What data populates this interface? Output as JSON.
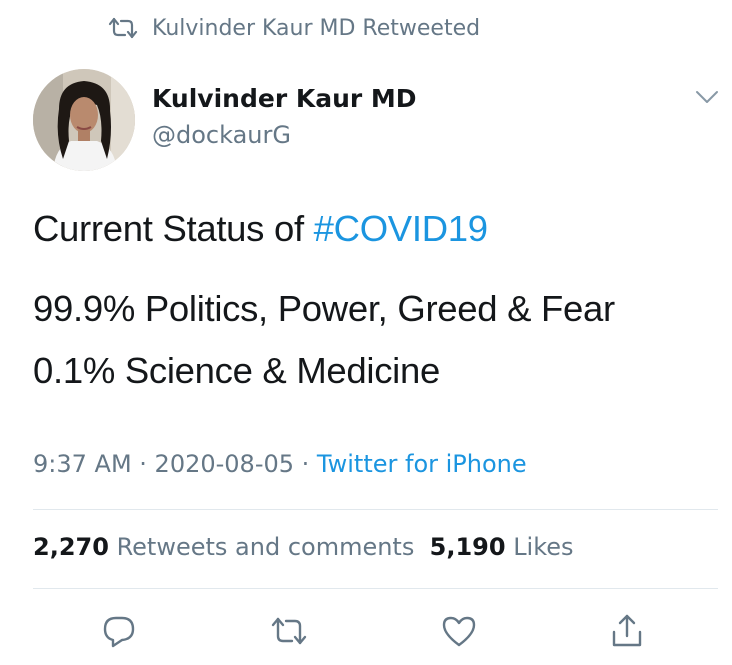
{
  "retweet_header": {
    "text": "Kulvinder Kaur MD Retweeted",
    "icon": "retweet-icon"
  },
  "author": {
    "display_name": "Kulvinder Kaur MD",
    "handle": "@dockaurG"
  },
  "tweet": {
    "line1_prefix": "Current Status of ",
    "hashtag": "#COVID19",
    "line2": "99.9% Politics, Power, Greed & Fear",
    "line3": "0.1% Science & Medicine"
  },
  "meta": {
    "time": "9:37 AM",
    "separator1": " · ",
    "date": "2020-08-05",
    "separator2": " · ",
    "source": "Twitter for iPhone"
  },
  "stats": {
    "retweets_count": "2,270",
    "retweets_label": "Retweets and comments",
    "likes_count": "5,190",
    "likes_label": "Likes"
  },
  "actions": [
    "reply-icon",
    "retweet-icon",
    "like-icon",
    "share-icon"
  ],
  "colors": {
    "link": "#1b95e0",
    "secondary_text": "#657786",
    "primary_text": "#14171a",
    "divider": "#e1e8ed"
  }
}
